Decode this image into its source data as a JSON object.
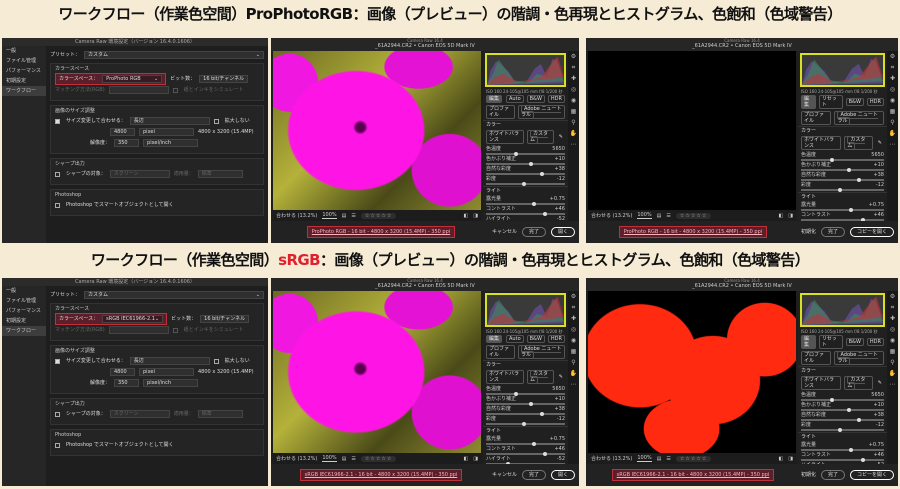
{
  "rows": [
    {
      "title": {
        "prefix": "ワークフロー（作業色空間）",
        "highlight": "ProPhotoRGB",
        "suffix": "：画像（プレビュー）の階調・色再現とヒストグラム、色飽和（色域警告）"
      },
      "color_space": "ProPhoto RGB",
      "workflow_link": "ProPhoto RGB - 16 bit - 4800 x 3200 (15.4MP) - 350 ppi",
      "preview": "magenta",
      "warning": "black"
    },
    {
      "title": {
        "prefix": "ワークフロー（作業色空間）",
        "highlight": "sRGB",
        "suffix": "：画像（プレビュー）の階調・色再現とヒストグラム、色飽和（色域警告）"
      },
      "color_space": "sRGB IEC61966-2.1",
      "workflow_link": "sRGB IEC61966-2.1 - 16 bit - 4800 x 3200 (15.4MP) - 350 ppi",
      "preview": "magenta",
      "warning": "red"
    }
  ],
  "prefs": {
    "title": "Camera Raw 環境設定（バージョン 16.4.0.1606）",
    "sidebar": [
      "一般",
      "ファイル管理",
      "パフォーマンス",
      "初期設定",
      "ワークフロー"
    ],
    "preset_label": "プリセット：",
    "preset_value": "カスタム",
    "cs_section": "カラースペース",
    "cs_label": "カラースペース：",
    "bit_label": "ビット数：",
    "bit_value": "16 bit/チャンネル",
    "intent_label": "マッチング方法(RGB)",
    "simulate": "紙とインキをシミュレート",
    "resize_section": "画像のサイズ調整",
    "resize_label": "サイズ変更して合わせる：",
    "resize_value": "長辺",
    "no_enlarge": "拡大しない",
    "size_value": "4800",
    "size_unit": "pixel",
    "size_info": "4800 x 3200 (15.4MP)",
    "res_label": "解像度：",
    "res_value": "350",
    "res_unit": "pixel/inch",
    "sharpen_section": "シャープ出力",
    "sharpen_label": "シャープの対象：",
    "sharpen_value": "スクリーン",
    "amount_label": "適用量：",
    "amount_value": "標準",
    "ps_section": "Photoshop",
    "ps_option": "Photoshop でスマートオブジェクトとして開く"
  },
  "editor": {
    "app_title": "Camera Raw 16.4",
    "file": "_61A2944.CR2 • Canon EOS 5D Mark IV",
    "meta": "ISO 160   24-105@105 mm   f/8   1/200 秒",
    "tab_edit": "編集",
    "tab_auto": "Auto",
    "tab_bw": "B&W",
    "tab_hdr": "HDR",
    "profile_label": "プロファイル",
    "profile_value": "Adobe ニュートラル",
    "color_section": "カラー",
    "wb_label": "ホワイトバランス",
    "wb_value": "カスタム",
    "color_sliders": [
      {
        "label": "色温度",
        "value": "5650",
        "pos": 0.35
      },
      {
        "label": "色かぶり補正",
        "value": "+10",
        "pos": 0.55
      },
      {
        "label": "自然な彩度",
        "value": "+38",
        "pos": 0.68
      },
      {
        "label": "彩度",
        "value": "-12",
        "pos": 0.45
      }
    ],
    "light_section": "ライト",
    "light_sliders": [
      {
        "label": "露光量",
        "value": "+0.75",
        "pos": 0.58
      },
      {
        "label": "コントラスト",
        "value": "+46",
        "pos": 0.72
      },
      {
        "label": "ハイライト",
        "value": "-52",
        "pos": 0.25
      }
    ],
    "fit": "合わせる (13.2%)",
    "zoom": "100%",
    "stars": "☆☆☆☆☆",
    "cancel": "キャンセル",
    "done": "完了",
    "open": "開く",
    "warn_title": "Camera Raw 16.4",
    "reset": "リセット",
    "reset_btn": "初期化",
    "open_copy": "コピーを開く"
  },
  "colors": {
    "accent": "#e0202a",
    "highlight_border": "#d8e021",
    "link_box": "#c0303a"
  }
}
